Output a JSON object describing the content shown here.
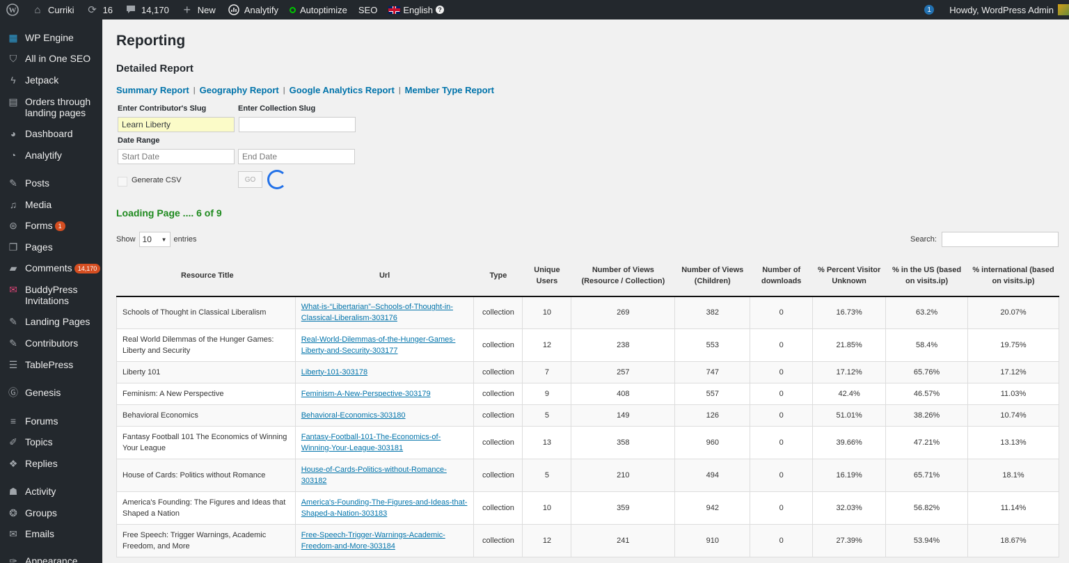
{
  "adminbar": {
    "site": "Curriki",
    "updates": "16",
    "comments": "14,170",
    "new": "New",
    "analytify": "Analytify",
    "autoptimize": "Autoptimize",
    "seo": "SEO",
    "language": "English",
    "notification_count": "1",
    "howdy": "Howdy, WordPress Admin"
  },
  "sidebar": {
    "items": [
      {
        "label": "WP Engine",
        "icon": "grid-icon"
      },
      {
        "label": "All in One SEO",
        "icon": "shield-icon"
      },
      {
        "label": "Jetpack",
        "icon": "bolt-icon"
      },
      {
        "label": "Orders through landing pages",
        "icon": "document-icon"
      },
      {
        "label": "Dashboard",
        "icon": "gauge-icon"
      },
      {
        "label": "Analytify",
        "icon": "chart-icon"
      },
      {
        "label": "Posts",
        "icon": "pin-icon"
      },
      {
        "label": "Media",
        "icon": "media-icon"
      },
      {
        "label": "Forms",
        "icon": "forms-icon",
        "badge": "1"
      },
      {
        "label": "Pages",
        "icon": "pages-icon"
      },
      {
        "label": "Comments",
        "icon": "comment-icon",
        "badge": "14,170"
      },
      {
        "label": "BuddyPress Invitations",
        "icon": "invite-icon"
      },
      {
        "label": "Landing Pages",
        "icon": "pin-icon"
      },
      {
        "label": "Contributors",
        "icon": "pin-icon"
      },
      {
        "label": "TablePress",
        "icon": "table-icon"
      },
      {
        "label": "Genesis",
        "icon": "genesis-icon"
      },
      {
        "label": "Forums",
        "icon": "forums-icon"
      },
      {
        "label": "Topics",
        "icon": "topics-icon"
      },
      {
        "label": "Replies",
        "icon": "replies-icon"
      },
      {
        "label": "Activity",
        "icon": "activity-icon"
      },
      {
        "label": "Groups",
        "icon": "groups-icon"
      },
      {
        "label": "Emails",
        "icon": "email-icon"
      },
      {
        "label": "Appearance",
        "icon": "brush-icon"
      }
    ]
  },
  "page": {
    "title": "Reporting",
    "subtitle": "Detailed Report",
    "links": [
      "Summary Report",
      "Geography Report",
      "Google Analytics Report",
      "Member Type Report"
    ],
    "contributor_label": "Enter Contributor's Slug",
    "contributor_value": "Learn Liberty",
    "collection_label": "Enter Collection Slug",
    "collection_value": "",
    "date_range_label": "Date Range",
    "start_placeholder": "Start Date",
    "end_placeholder": "End Date",
    "csv_label": "Generate CSV",
    "go_label": "GO",
    "loading": "Loading Page .... 6 of 9",
    "show_label": "Show",
    "show_value": "10",
    "entries_label": "entries",
    "search_label": "Search:"
  },
  "table": {
    "headers": [
      "Resource Title",
      "Url",
      "Type",
      "Unique Users",
      "Number of Views (Resource / Collection)",
      "Number of Views (Children)",
      "Number of downloads",
      "% Percent Visitor Unknown",
      "% in the US (based on visits.ip)",
      "% international (based on visits.ip)"
    ],
    "rows": [
      {
        "title": "Schools of Thought in Classical Liberalism",
        "url": "What-is-“Libertarian”–Schools-of-Thought-in-Classical-Liberalism-303176",
        "type": "collection",
        "users": "10",
        "views": "269",
        "children": "382",
        "downloads": "0",
        "unknown": "16.73%",
        "us": "63.2%",
        "intl": "20.07%"
      },
      {
        "title": "Real World Dilemmas of the Hunger Games: Liberty and Security",
        "url": "Real-World-Dilemmas-of-the-Hunger-Games-Liberty-and-Security-303177",
        "type": "collection",
        "users": "12",
        "views": "238",
        "children": "553",
        "downloads": "0",
        "unknown": "21.85%",
        "us": "58.4%",
        "intl": "19.75%"
      },
      {
        "title": "Liberty 101",
        "url": "Liberty-101-303178",
        "type": "collection",
        "users": "7",
        "views": "257",
        "children": "747",
        "downloads": "0",
        "unknown": "17.12%",
        "us": "65.76%",
        "intl": "17.12%"
      },
      {
        "title": "Feminism: A New Perspective",
        "url": "Feminism-A-New-Perspective-303179",
        "type": "collection",
        "users": "9",
        "views": "408",
        "children": "557",
        "downloads": "0",
        "unknown": "42.4%",
        "us": "46.57%",
        "intl": "11.03%"
      },
      {
        "title": "Behavioral Economics",
        "url": "Behavioral-Economics-303180",
        "type": "collection",
        "users": "5",
        "views": "149",
        "children": "126",
        "downloads": "0",
        "unknown": "51.01%",
        "us": "38.26%",
        "intl": "10.74%"
      },
      {
        "title": "Fantasy Football 101 The Economics of Winning Your League",
        "url": "Fantasy-Football-101-The-Economics-of-Winning-Your-League-303181",
        "type": "collection",
        "users": "13",
        "views": "358",
        "children": "960",
        "downloads": "0",
        "unknown": "39.66%",
        "us": "47.21%",
        "intl": "13.13%"
      },
      {
        "title": "House of Cards: Politics without Romance",
        "url": "House-of-Cards-Politics-without-Romance-303182",
        "type": "collection",
        "users": "5",
        "views": "210",
        "children": "494",
        "downloads": "0",
        "unknown": "16.19%",
        "us": "65.71%",
        "intl": "18.1%"
      },
      {
        "title": "America's Founding: The Figures and Ideas that Shaped a Nation",
        "url": "America's-Founding-The-Figures-and-Ideas-that-Shaped-a-Nation-303183",
        "type": "collection",
        "users": "10",
        "views": "359",
        "children": "942",
        "downloads": "0",
        "unknown": "32.03%",
        "us": "56.82%",
        "intl": "11.14%"
      },
      {
        "title": "Free Speech: Trigger Warnings, Academic Freedom, and More",
        "url": "Free-Speech-Trigger-Warnings-Academic-Freedom-and-More-303184",
        "type": "collection",
        "users": "12",
        "views": "241",
        "children": "910",
        "downloads": "0",
        "unknown": "27.39%",
        "us": "53.94%",
        "intl": "18.67%"
      }
    ]
  }
}
